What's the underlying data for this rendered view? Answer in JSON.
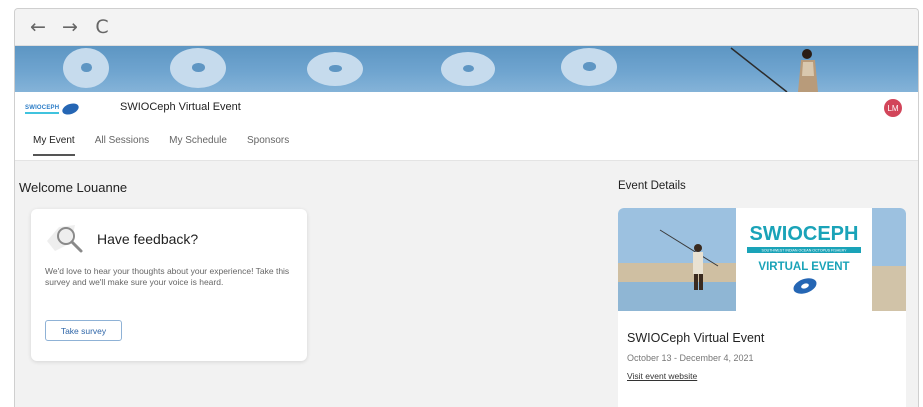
{
  "browser": {
    "back_icon": "←",
    "forward_icon": "→",
    "reload_icon": "C"
  },
  "header": {
    "logo_text": "SWIOCEPH",
    "event_title": "SWIOCeph Virtual Event",
    "avatar_initials": "LM",
    "avatar_color": "#d2455a"
  },
  "tabs": [
    {
      "label": "My Event",
      "active": true
    },
    {
      "label": "All Sessions",
      "active": false
    },
    {
      "label": "My Schedule",
      "active": false
    },
    {
      "label": "Sponsors",
      "active": false
    }
  ],
  "main": {
    "welcome": "Welcome Louanne",
    "feedback": {
      "heading": "Have feedback?",
      "text": "We'd love to hear your thoughts about your experience! Take this survey and we'll make sure your voice is heard.",
      "button": "Take survey"
    },
    "details": {
      "heading": "Event Details",
      "image_title_1": "SWIOCEPH",
      "image_subtitle": "SOUTHWEST INDIAN OCEAN OCTOPUS FISHERY",
      "image_title_2": "VIRTUAL EVENT",
      "event_name": "SWIOCeph Virtual Event",
      "dates": "October 13 - December 4, 2021",
      "link": "Visit event website"
    }
  },
  "colors": {
    "accent": "#2f66a8",
    "brand_teal": "#1aa3b8",
    "brand_blue": "#2566b4"
  }
}
